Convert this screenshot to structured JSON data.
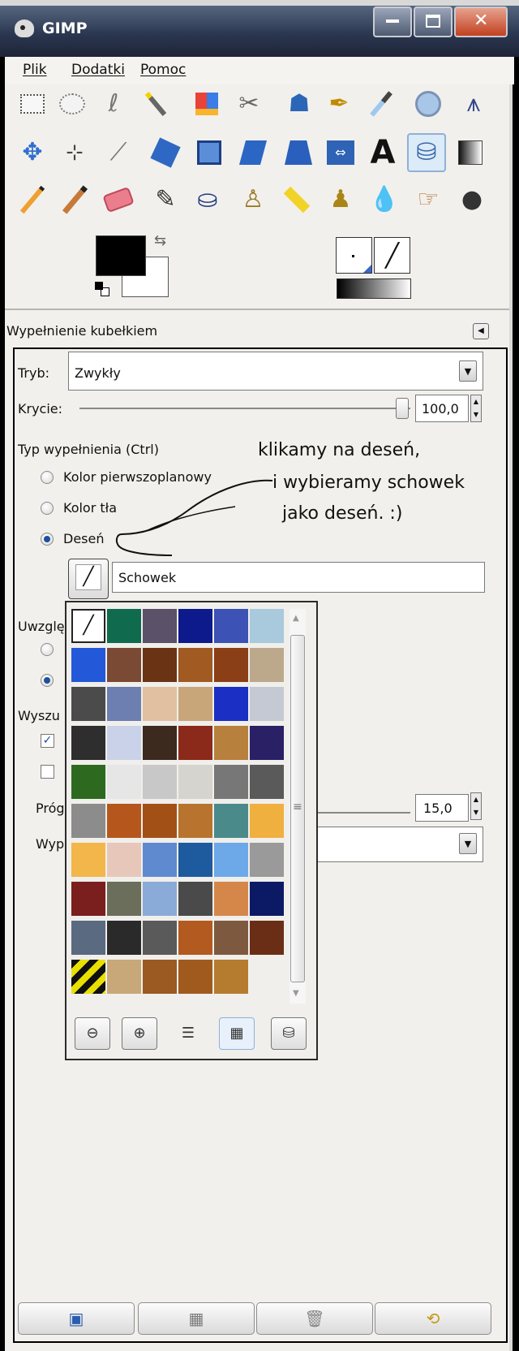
{
  "window": {
    "title": "GIMP"
  },
  "menu": [
    "Plik",
    "Dodatki",
    "Pomoc"
  ],
  "toolbox": {
    "row1": [
      "rect-select-icon",
      "ellipse-select-icon",
      "free-select-icon",
      "fuzzy-select-icon",
      "color-select-icon",
      "scissors-select-icon",
      "foreground-select-icon",
      "paths-icon",
      "color-picker-icon",
      "zoom-icon",
      "measure-icon"
    ],
    "row2": [
      "move-icon",
      "align-icon",
      "crop-icon",
      "rotate-icon",
      "scale-icon",
      "shear-icon",
      "perspective-icon",
      "flip-icon",
      "text-icon",
      "bucket-fill-icon",
      "blend-icon"
    ],
    "row3": [
      "pencil-icon",
      "paintbrush-icon",
      "eraser-icon",
      "airbrush-icon",
      "ink-icon",
      "clone-icon",
      "heal-icon",
      "perspective-clone-icon",
      "blur-icon",
      "smudge-icon",
      "dodge-burn-icon"
    ],
    "active": "bucket-fill-icon",
    "fg_color": "#000000",
    "bg_color": "#ffffff"
  },
  "options": {
    "title": "Wypełnienie kubełkiem",
    "mode_label": "Tryb:",
    "mode_value": "Zwykły",
    "opacity_label": "Krycie:",
    "opacity_value": "100,0",
    "fill_type_label": "Typ wypełnienia  (Ctrl)",
    "fill_fg": "Kolor pierwszoplanowy",
    "fill_bg": "Kolor tła",
    "fill_pattern": "Deseń",
    "pattern_name": "Schowek",
    "affected_label": "Uwzglę",
    "find_label": "Wyszu",
    "threshold_label": "Próg",
    "threshold_value": "15,0",
    "fill_by_label": "Wyp"
  },
  "annotation": {
    "line1": "klikamy na deseń,",
    "line2": "i wybieramy schowek",
    "line3": "jako deseń. :)"
  },
  "patterns": [
    [
      "#ffffff",
      "#0f6a4e",
      "#5b5168",
      "#0c1a8c",
      "#3c52b4",
      "#a9c9dc"
    ],
    [
      "#2358d8",
      "#7a4a35",
      "#6a3414",
      "#a05a22",
      "#8a3f17",
      "#bca98b"
    ],
    [
      "#4b4b4b",
      "#6d7fb0",
      "#e0c0a0",
      "#c9a67a",
      "#1b2fc4",
      "#c4c9d4"
    ],
    [
      "#2e2e2e",
      "#c9d2e8",
      "#3d2a1f",
      "#8b2a1a",
      "#b7803c",
      "#2a2066"
    ],
    [
      "#2d6a1f",
      "#e6e6e6",
      "#c8c8c8",
      "#d6d4cf",
      "#777777",
      "#5a5a5a"
    ],
    [
      "#8c8c8c",
      "#b5571c",
      "#a35016",
      "#b8742e",
      "#4a8a8a",
      "#f0b040"
    ],
    [
      "#f2b64a",
      "#e8c7bb",
      "#5f8ad0",
      "#1e5a9e",
      "#6da8e8",
      "#9a9a9a"
    ],
    [
      "#7a1e1e",
      "#6a6e5a",
      "#8aaad8",
      "#4a4a4a",
      "#d5874a",
      "#0c1a66"
    ],
    [
      "#5a6a80",
      "#2a2a2a",
      "#5a5a5a",
      "#b35a20",
      "#7d5a3f",
      "#6a2e17"
    ],
    [
      "#e8e000",
      "#c8a878",
      "#9a5a22",
      "#a05a1e",
      "#b57b2e",
      ""
    ]
  ],
  "pattern_names": [
    "swatch-clipboard",
    "swatch-marble-green",
    "swatch-stone",
    "swatch-blue",
    "swatch-blue-texture",
    "swatch-pixels"
  ],
  "bottom_buttons": [
    "save-options-button",
    "restore-options-button",
    "delete-options-button",
    "reset-options-button"
  ]
}
